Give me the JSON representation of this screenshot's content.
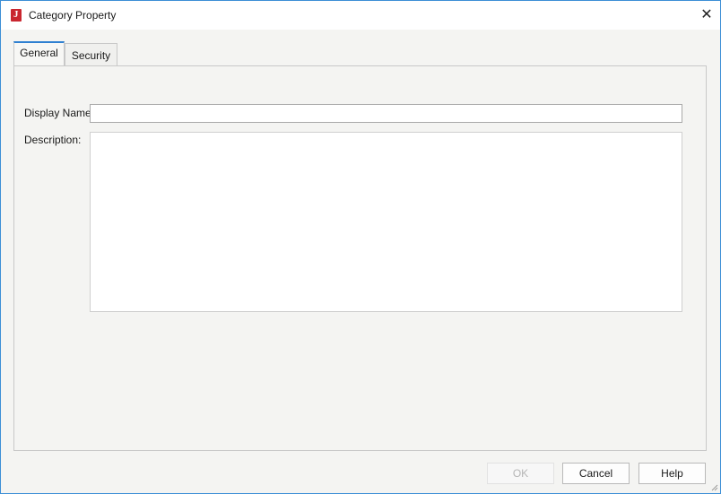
{
  "window": {
    "title": "Category Property",
    "icon": "j-app-icon",
    "icon_letter": "J",
    "close_glyph": "✕",
    "accent": "#2f80d1",
    "icon_color": "#c9262f"
  },
  "tabs": [
    {
      "label": "General",
      "active": true
    },
    {
      "label": "Security",
      "active": false
    }
  ],
  "form": {
    "display_name_label": "Display Name:",
    "display_name_value": "",
    "description_label": "Description:",
    "description_value": ""
  },
  "buttons": {
    "ok": "OK",
    "cancel": "Cancel",
    "help": "Help"
  }
}
